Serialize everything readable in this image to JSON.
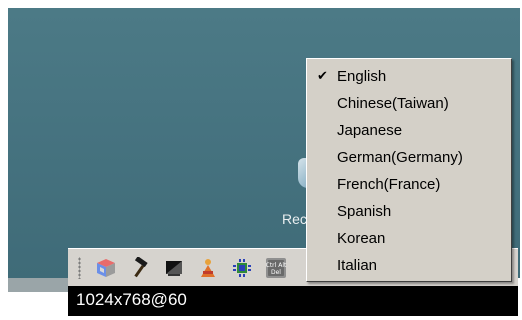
{
  "desktop": {
    "icon": "recycle-bin-icon",
    "label": "Rec"
  },
  "toolbar": {
    "buttons": [
      {
        "icon": "cube-icon"
      },
      {
        "icon": "hammer-icon"
      },
      {
        "icon": "display-icon"
      },
      {
        "icon": "figure-icon"
      },
      {
        "icon": "chip-icon"
      },
      {
        "icon": "ctrl-alt-del-icon",
        "label": "Ctrl Alt Del"
      }
    ]
  },
  "status": {
    "resolution": "1024x768@60"
  },
  "language_menu": {
    "selected": "English",
    "items": [
      {
        "label": "English",
        "checked": true
      },
      {
        "label": "Chinese(Taiwan)",
        "checked": false
      },
      {
        "label": "Japanese",
        "checked": false
      },
      {
        "label": "German(Germany)",
        "checked": false
      },
      {
        "label": "French(France)",
        "checked": false
      },
      {
        "label": "Spanish",
        "checked": false
      },
      {
        "label": "Korean",
        "checked": false
      },
      {
        "label": "Italian",
        "checked": false
      }
    ]
  }
}
